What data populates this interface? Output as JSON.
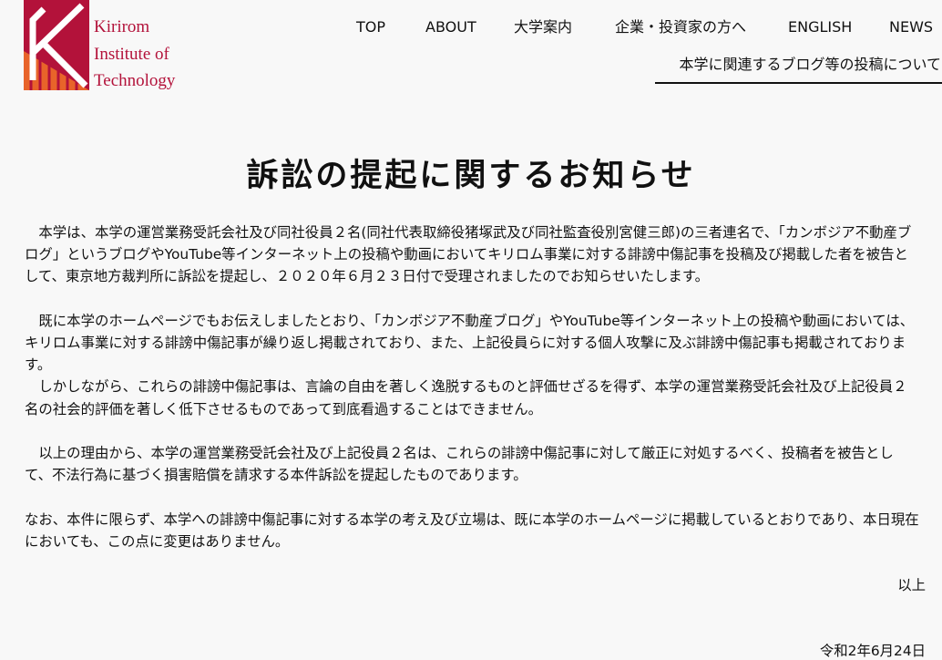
{
  "logo": {
    "line1": "Kirirom",
    "line2": "Institute of",
    "line3": "Technology"
  },
  "nav": {
    "items": [
      "TOP",
      "ABOUT",
      "大学案内",
      "企業・投資家の方へ",
      "ENGLISH",
      "NEWS"
    ]
  },
  "sub_link": "本学に関連するブログ等の投稿について",
  "notice": {
    "title": "訴訟の提起に関するお知らせ",
    "paragraphs": [
      "　本学は、本学の運営業務受託会社及び同社役員２名(同社代表取締役猪塚武及び同社監査役別宮健三郎)の三者連名で、「カンボジア不動産ブログ」というブログやYouTube等インターネット上の投稿や動画においてキリロム事業に対する誹謗中傷記事を投稿及び掲載した者を被告として、東京地方裁判所に訴訟を提起し、２０２０年６月２３日付で受理されましたのでお知らせいたします。",
      "　既に本学のホームページでもお伝えしましたとおり、「カンボジア不動産ブログ」やYouTube等インターネット上の投稿や動画においては、キリロム事業に対する誹謗中傷記事が繰り返し掲載されており、また、上記役員らに対する個人攻撃に及ぶ誹謗中傷記事も掲載されております。",
      "　しかしながら、これらの誹謗中傷記事は、言論の自由を著しく逸脱するものと評価せざるを得ず、本学の運営業務受託会社及び上記役員２名の社会的評価を著しく低下させるものであって到底看過することはできません。",
      "　以上の理由から、本学の運営業務受託会社及び上記役員２名は、これらの誹謗中傷記事に対して厳正に対処するべく、投稿者を被告として、不法行為に基づく損害賠償を請求する本件訴訟を提起したものであります。",
      "なお、本件に限らず、本学への誹謗中傷記事に対する本学の考え及び立場は、既に本学のホームページに掲載しているとおりであり、本日現在においても、この点に変更はありません。"
    ],
    "closing": "以上",
    "date": "令和2年6月24日"
  },
  "colors": {
    "brand_red": "#b3123a",
    "brand_orange": "#e8642a"
  }
}
